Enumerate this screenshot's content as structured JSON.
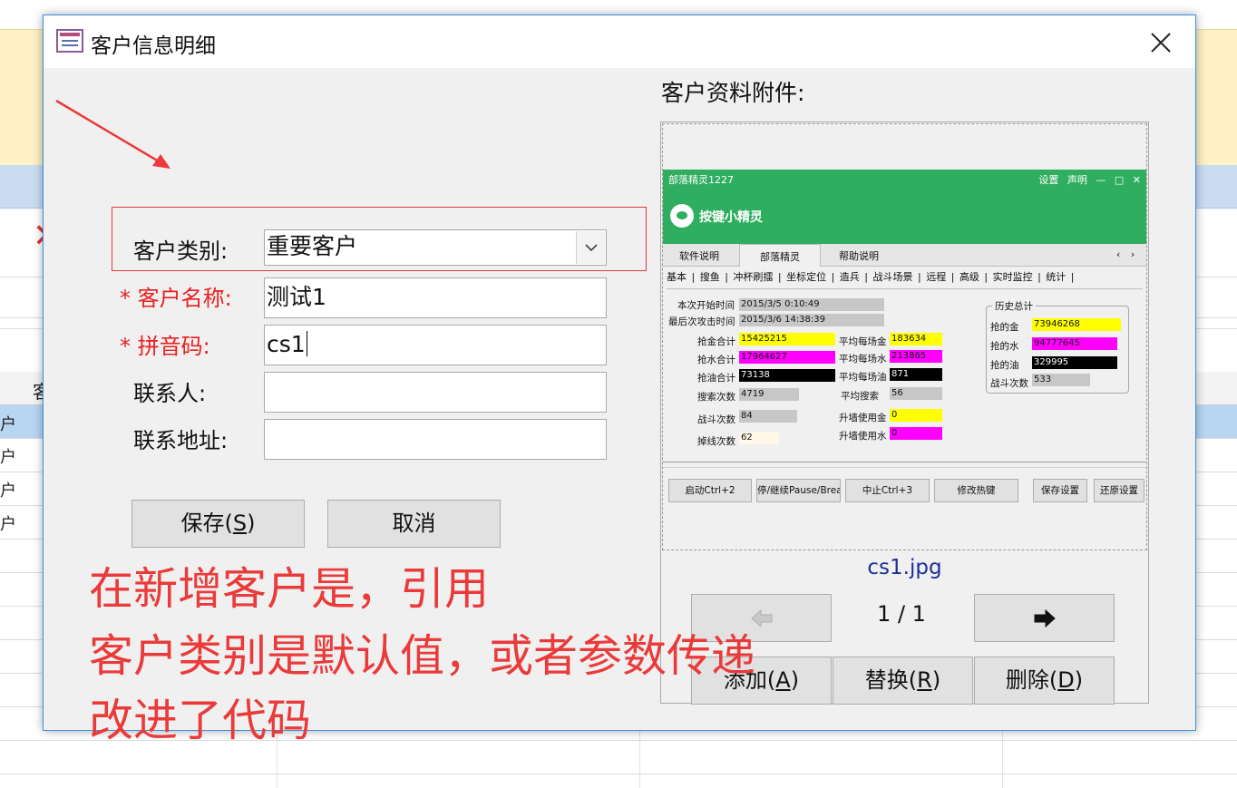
{
  "dialog": {
    "title": "客户信息明细",
    "close_glyph": "✕"
  },
  "form": {
    "category_label": "客户类别:",
    "category_value": "重要客户",
    "name_required_mark": "*",
    "name_label": "客户名称:",
    "name_value": "测试1",
    "pinyin_required_mark": "*",
    "pinyin_label": "拼音码:",
    "pinyin_value": "cs1",
    "contact_label": "联系人:",
    "contact_value": "",
    "address_label": "联系地址:",
    "address_value": "",
    "save_label": "保存(",
    "save_key": "S",
    "save_close": ")",
    "cancel_label": "取消"
  },
  "attachment": {
    "title": "客户资料附件:",
    "file_name": "cs1.jpg",
    "page_indicator": "1 / 1",
    "add_label": "添加(",
    "add_key": "A",
    "add_close": ")",
    "replace_label": "替换(",
    "replace_key": "R",
    "replace_close": ")",
    "delete_label": "删除(",
    "delete_key": "D",
    "delete_close": ")"
  },
  "attachment_image": {
    "window_title": "部落精灵1227",
    "window_menu": "设置 声明 — □ ✕",
    "brand": "按键小精灵",
    "tabs": [
      "软件说明",
      "部落精灵",
      "帮助说明"
    ],
    "tab_scroll": "‹ ›",
    "subtabs": "基本 | 搜鱼 | 冲杯刷擂 | 坐标定位 | 造兵 | 战斗场景 | 远程 | 高级 | 实时监控 | 统计 |",
    "start_time_label": "本次开始时间",
    "start_time_value": "2015/3/5 0:10:49",
    "last_attack_label": "最后次攻击时间",
    "last_attack_value": "2015/3/6 14:38:39",
    "gold_total_label": "抢金合计",
    "gold_total_value": "15425215",
    "water_total_label": "抢水合计",
    "water_total_value": "17964627",
    "oil_total_label": "抢油合计",
    "oil_total_value": "73138",
    "search_count_label": "搜索次数",
    "search_count_value": "4719",
    "battle_count_label": "战斗次数",
    "battle_count_value": "84",
    "disconnect_label": "掉线次数",
    "disconnect_value": "62",
    "avg_gold_label": "平均每场金",
    "avg_gold_value": "183634",
    "avg_water_label": "平均每场水",
    "avg_water_value": "213865",
    "avg_oil_label": "平均每场油",
    "avg_oil_value": "871",
    "avg_search_label": "平均搜索",
    "avg_search_value": "56",
    "wall_gold_label": "升墙使用金",
    "wall_gold_value": "0",
    "wall_water_label": "升墙使用水",
    "wall_water_value": "0",
    "history_title": "历史总计",
    "hist_gold_label": "抢的金",
    "hist_gold_value": "73946268",
    "hist_water_label": "抢的水",
    "hist_water_value": "94777645",
    "hist_oil_label": "抢的油",
    "hist_oil_value": "329995",
    "hist_battle_label": "战斗次数",
    "hist_battle_value": "533",
    "buttons": [
      "启动Ctrl+2",
      "停/继续Pause/Break",
      "中止Ctrl+3",
      "修改热键",
      "保存设置",
      "还原设置"
    ]
  },
  "annotation": {
    "lines": [
      "在新增客户是，引用",
      "客户类别是默认值，或者参数传递",
      "改进了代码"
    ]
  },
  "background": {
    "cells": [
      "户",
      "户",
      "户",
      "户"
    ],
    "header_fragment": "客"
  },
  "colors": {
    "annotation_red": "#ea3a3a",
    "required_red": "#e81f1f",
    "dialog_border": "#3a8ee6",
    "file_name_blue": "#1b2f9a",
    "app_green": "#2fae5f",
    "bar_yellow": "#ffff00",
    "bar_magenta": "#ff00ff",
    "bar_black": "#000000"
  }
}
